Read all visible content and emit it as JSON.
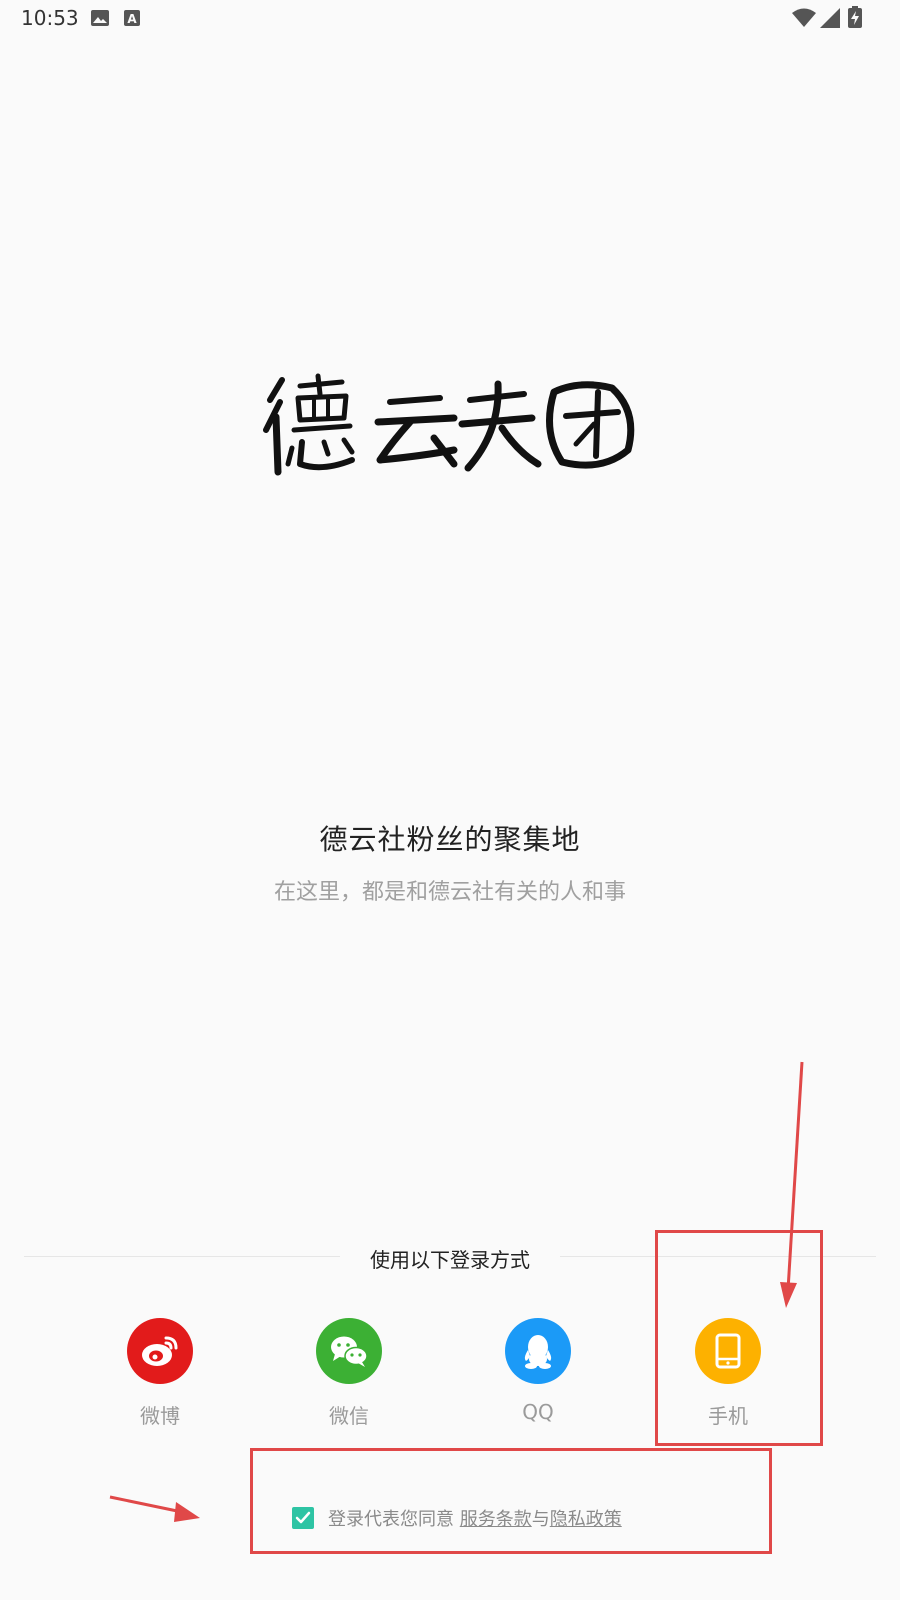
{
  "status_bar": {
    "time": "10:53"
  },
  "app": {
    "logo_text": "德云天团",
    "tagline": "德云社粉丝的聚集地",
    "subline": "在这里，都是和德云社有关的人和事"
  },
  "login": {
    "title": "使用以下登录方式",
    "options": [
      {
        "label": "微博",
        "icon": "weibo-icon",
        "color": "#e21b1b"
      },
      {
        "label": "微信",
        "icon": "wechat-icon",
        "color": "#3cb034"
      },
      {
        "label": "QQ",
        "icon": "qq-icon",
        "color": "#1b9af7"
      },
      {
        "label": "手机",
        "icon": "phone-icon",
        "color": "#fdb100"
      }
    ]
  },
  "agreement": {
    "checked": true,
    "prefix": "登录代表您同意 ",
    "terms_link": "服务条款",
    "joiner": "与",
    "privacy_link": "隐私政策"
  },
  "colors": {
    "background": "#fafafa",
    "annotation": "#e04848",
    "checkbox": "#2ec4a4"
  }
}
